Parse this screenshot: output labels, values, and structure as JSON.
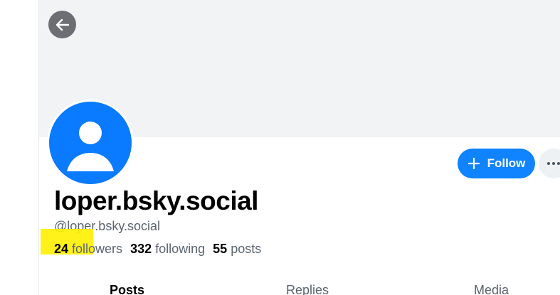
{
  "profile": {
    "display_name": "loper.bsky.social",
    "handle": "@loper.bsky.social",
    "followers_count": "24",
    "followers_label": "followers",
    "following_count": "332",
    "following_label": "following",
    "posts_count": "55",
    "posts_label": "posts"
  },
  "actions": {
    "follow_label": "Follow"
  },
  "tabs": [
    {
      "label": "Posts",
      "active": true
    },
    {
      "label": "Replies",
      "active": false
    },
    {
      "label": "Media",
      "active": false
    }
  ],
  "colors": {
    "accent": "#1083fe",
    "avatar": "#0a7aff",
    "banner": "#f1f3f5",
    "highlight": "#ffef00"
  },
  "icons": {
    "back": "arrow-left-icon",
    "follow": "plus-icon",
    "more": "more-horizontal-icon",
    "avatar": "default-avatar-icon"
  }
}
